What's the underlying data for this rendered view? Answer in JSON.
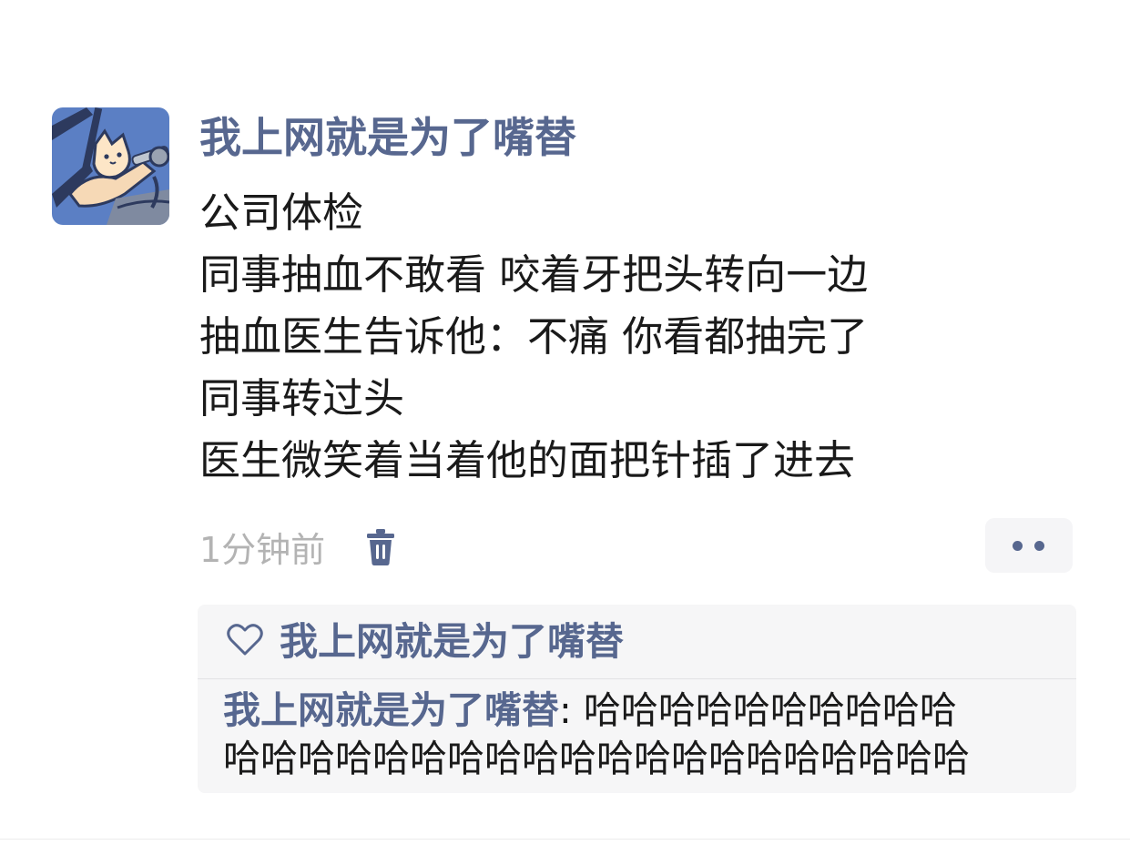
{
  "post": {
    "avatar_icon": "cat-avatar-icon",
    "username": "我上网就是为了嘴替",
    "content_lines": [
      "公司体检",
      "同事抽血不敢看 咬着牙把头转向一边",
      "抽血医生告诉他：不痛 你看都抽完了",
      "同事转过头",
      "医生微笑着当着他的面把针插了进去"
    ],
    "timestamp": "1分钟前",
    "delete_icon": "trash-icon",
    "more_icon": "more-dots-icon"
  },
  "interaction": {
    "like_icon": "heart-icon",
    "liked_by": "我上网就是为了嘴替",
    "comment": {
      "author": "我上网就是为了嘴替",
      "separator": ": ",
      "text_line1": "哈哈哈哈哈哈哈哈哈哈",
      "text_line2": "哈哈哈哈哈哈哈哈哈哈哈哈哈哈哈哈哈哈哈哈"
    }
  },
  "colors": {
    "accent": "#57678f",
    "text": "#1a1a1a",
    "muted": "#b3b3b3",
    "panel": "#f6f6f7",
    "avatar_bg": "#5b7fc4"
  }
}
